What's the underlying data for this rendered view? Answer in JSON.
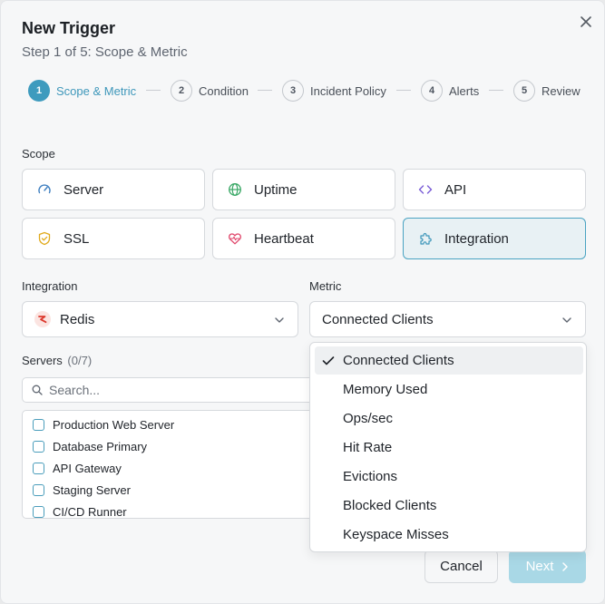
{
  "dialog": {
    "title": "New Trigger",
    "subtitle": "Step 1 of 5: Scope & Metric"
  },
  "stepper": [
    {
      "num": "1",
      "label": "Scope & Metric",
      "active": true
    },
    {
      "num": "2",
      "label": "Condition",
      "active": false
    },
    {
      "num": "3",
      "label": "Incident Policy",
      "active": false
    },
    {
      "num": "4",
      "label": "Alerts",
      "active": false
    },
    {
      "num": "5",
      "label": "Review",
      "active": false
    }
  ],
  "scope": {
    "label": "Scope",
    "options": [
      {
        "label": "Server",
        "icon": "gauge-icon"
      },
      {
        "label": "Uptime",
        "icon": "globe-icon"
      },
      {
        "label": "API",
        "icon": "code-icon"
      },
      {
        "label": "SSL",
        "icon": "shield-icon"
      },
      {
        "label": "Heartbeat",
        "icon": "heart-pulse-icon"
      },
      {
        "label": "Integration",
        "icon": "puzzle-icon",
        "selected": true
      }
    ]
  },
  "integration": {
    "label": "Integration",
    "value": "Redis"
  },
  "metric": {
    "label": "Metric",
    "value": "Connected Clients",
    "options": [
      "Connected Clients",
      "Memory Used",
      "Ops/sec",
      "Hit Rate",
      "Evictions",
      "Blocked Clients",
      "Keyspace Misses"
    ],
    "selected_index": 0
  },
  "servers": {
    "label": "Servers",
    "count": "(0/7)",
    "search_placeholder": "Search...",
    "items": [
      "Production Web Server",
      "Database Primary",
      "API Gateway",
      "Staging Server",
      "CI/CD Runner"
    ]
  },
  "footer": {
    "cancel_label": "Cancel",
    "next_label": "Next"
  },
  "colors": {
    "accent": "#3e9bbe",
    "next_disabled": "#a9d8e6",
    "selected_card_bg": "#e8f1f4"
  }
}
